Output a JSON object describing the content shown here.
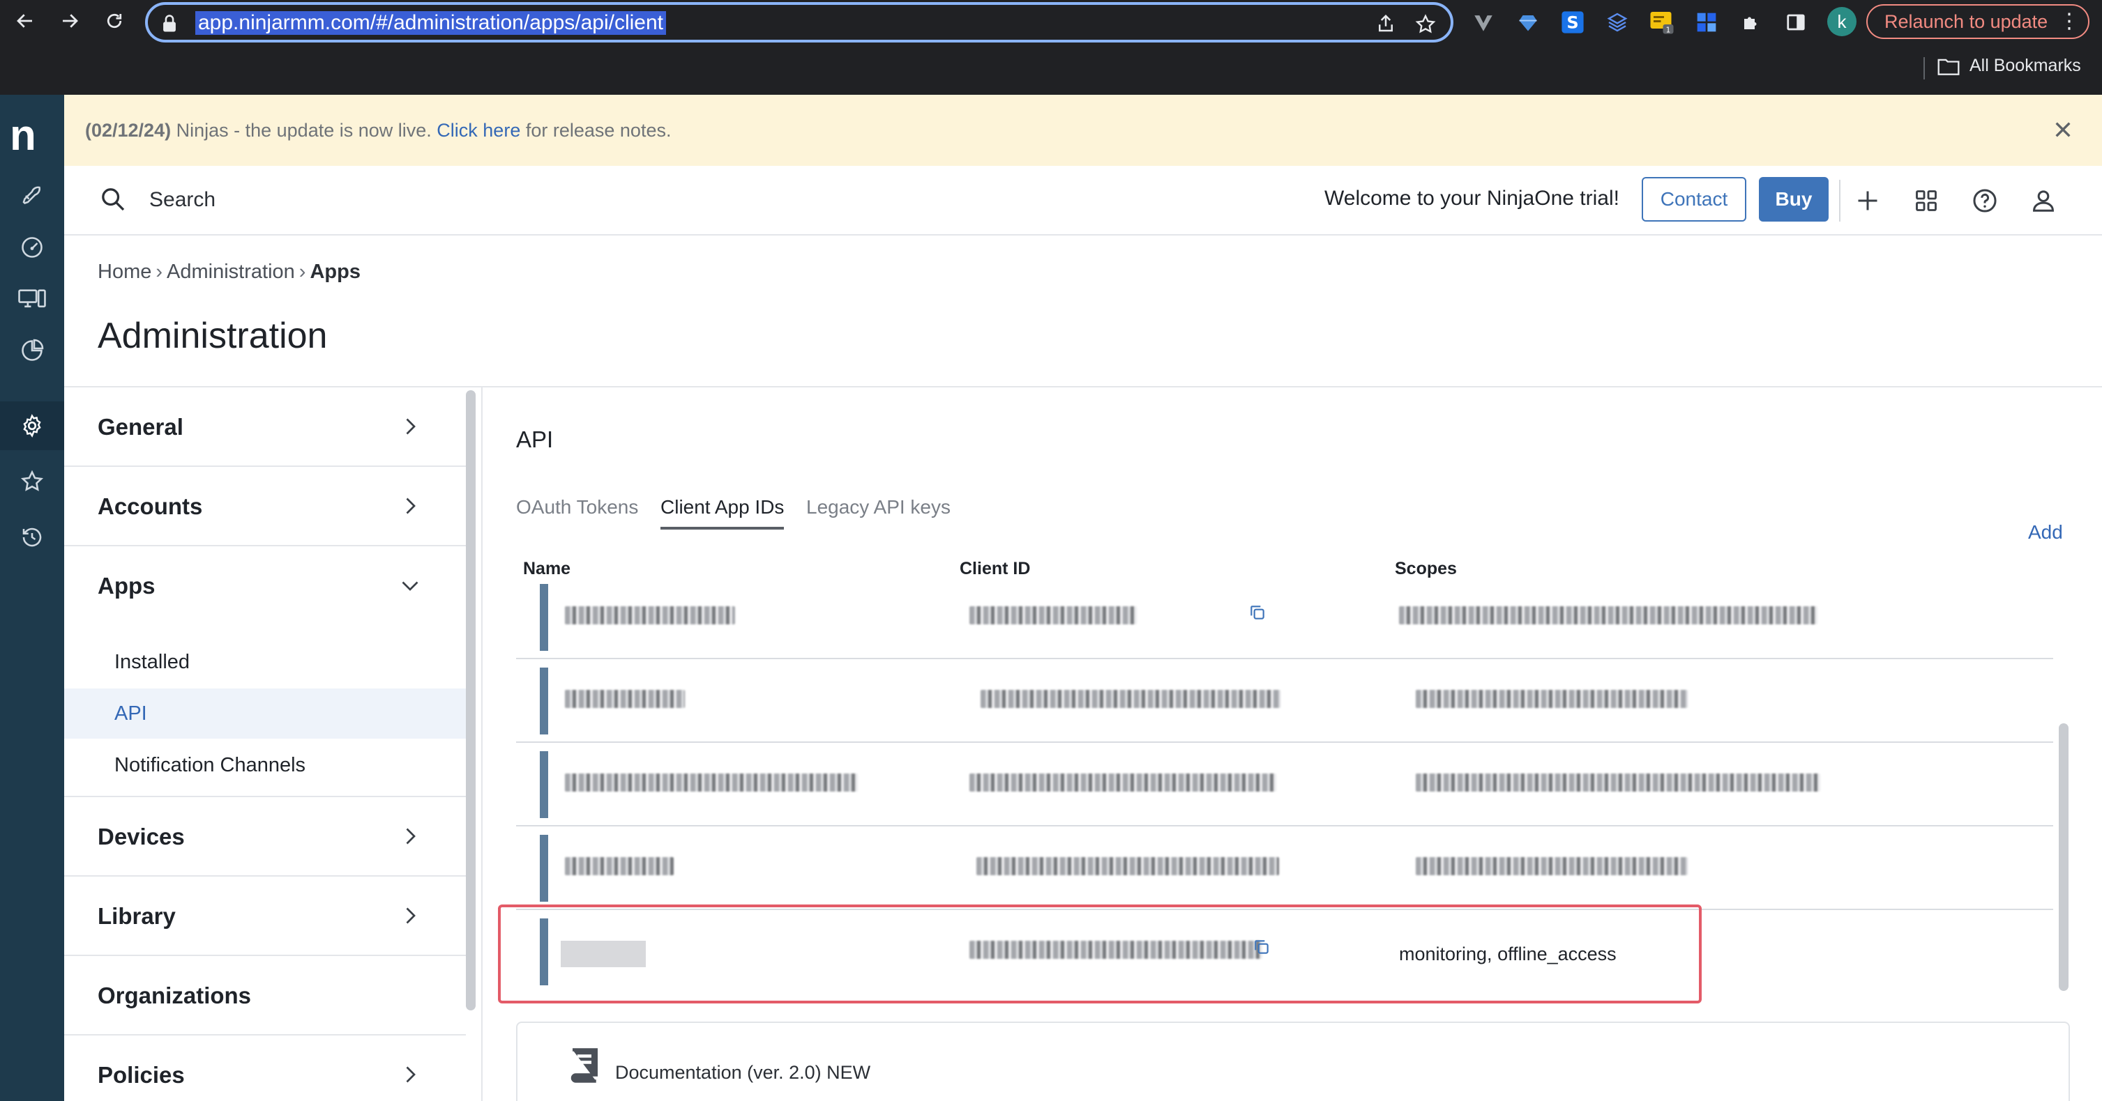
{
  "browser": {
    "url": "app.ninjarmm.com/#/administration/apps/api/client",
    "relaunch_label": "Relaunch to update",
    "profile_initial": "k",
    "bookmarks_label": "All Bookmarks",
    "extension_badge": "1"
  },
  "rail": {
    "logo": "n",
    "items": [
      "rocket-icon",
      "gauge-icon",
      "devices-icon",
      "chart-pie-icon",
      "gear-icon",
      "star-icon",
      "history-icon"
    ],
    "active": "gear-icon"
  },
  "banner": {
    "date": "(02/12/24)",
    "text_before_link": " Ninjas - the update is now live. ",
    "link": "Click here",
    "text_after_link": " for release notes."
  },
  "header": {
    "search_label": "Search",
    "welcome": "Welcome to your NinjaOne trial!",
    "contact_label": "Contact",
    "buy_label": "Buy"
  },
  "breadcrumb": {
    "home": "Home",
    "administration": "Administration",
    "current": "Apps"
  },
  "page_title": "Administration",
  "side_menu": {
    "general": "General",
    "accounts": "Accounts",
    "apps": "Apps",
    "apps_sub": [
      "Installed",
      "API",
      "Notification Channels"
    ],
    "apps_sub_active": "API",
    "devices": "Devices",
    "library": "Library",
    "organizations": "Organizations",
    "policies": "Policies"
  },
  "api": {
    "title": "API",
    "tabs": [
      "OAuth Tokens",
      "Client App IDs",
      "Legacy API keys"
    ],
    "active_tab": "Client App IDs",
    "add_label": "Add",
    "columns": [
      "Name",
      "Client ID",
      "Scopes"
    ],
    "last_row_scopes": "monitoring, offline_access",
    "documentation_label": "Documentation (ver. 2.0) NEW"
  },
  "colors": {
    "accent": "#3e74b9",
    "rail": "#1e3a4c",
    "banner": "#fdf4d9",
    "highlight": "#e35b68"
  }
}
